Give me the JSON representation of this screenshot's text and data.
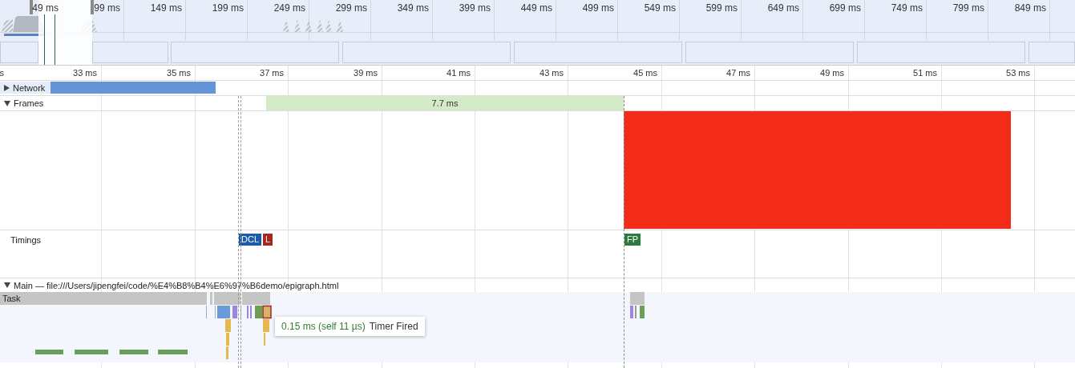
{
  "overview": {
    "ticks": [
      "49 ms",
      "99 ms",
      "149 ms",
      "199 ms",
      "249 ms",
      "299 ms",
      "349 ms",
      "399 ms",
      "449 ms",
      "499 ms",
      "549 ms",
      "599 ms",
      "649 ms",
      "699 ms",
      "749 ms",
      "799 ms",
      "849 ms"
    ]
  },
  "ruler": {
    "ticks": [
      "s",
      "33 ms",
      "35 ms",
      "37 ms",
      "39 ms",
      "41 ms",
      "43 ms",
      "45 ms",
      "47 ms",
      "49 ms",
      "51 ms",
      "53 ms"
    ]
  },
  "tracks": [
    {
      "kind": "network",
      "label": "Network",
      "expanded": false
    },
    {
      "kind": "frames",
      "label": "Frames",
      "expanded": true,
      "frame_duration": "7.7 ms"
    },
    {
      "kind": "timings",
      "label": "Timings",
      "markers": [
        {
          "label": "DCL",
          "color": "#1c5ba8"
        },
        {
          "label": "L",
          "color": "#a3281f"
        },
        {
          "label": "FP",
          "color": "#2e7a3e"
        }
      ]
    },
    {
      "kind": "main",
      "label": "Main — file:///Users/jipengfei/code/%E4%B8%B4%E6%97%B6demo/epigraph.html",
      "expanded": true,
      "task_label": "Task",
      "tooltip": {
        "duration": "0.15 ms (self 11 µs)",
        "name": "Timer Fired"
      }
    }
  ]
}
